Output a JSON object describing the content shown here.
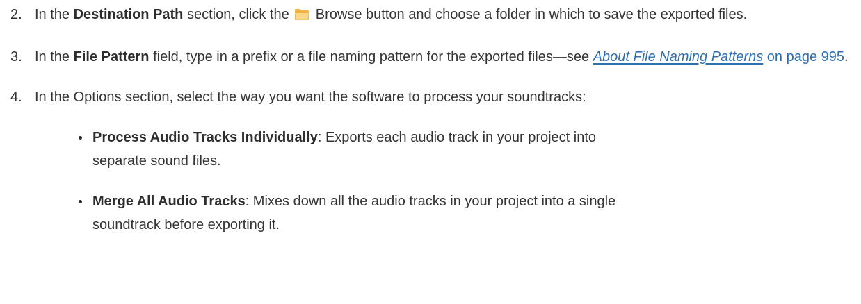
{
  "steps": [
    {
      "number": "2.",
      "intro": "In the ",
      "bold": "Destination Path",
      "middle": " section, click the ",
      "icon": "folder-icon",
      "after_icon": " Browse button and choose a folder in which to save the exported files."
    },
    {
      "number": "3.",
      "intro": "In the ",
      "bold": "File Pattern",
      "middle": " field, type in a prefix or a file naming pattern for the exported files—see ",
      "link_title": "About File Naming Patterns",
      "link_page": " on page 995",
      "end": "."
    },
    {
      "number": "4.",
      "text": "In the Options section, select the way you want the software to process your soundtracks:"
    }
  ],
  "bullets": [
    {
      "bold": "Process Audio Tracks Individually",
      "text": ": Exports each audio track in your project into separate sound files."
    },
    {
      "bold": "Merge All Audio Tracks",
      "text": ": Mixes down all the audio tracks in your project into a single soundtrack before exporting it."
    }
  ],
  "colors": {
    "text": "#343434",
    "link": "#2f6fb0",
    "folder_body": "#f6c05a",
    "folder_front": "#fbd889"
  }
}
